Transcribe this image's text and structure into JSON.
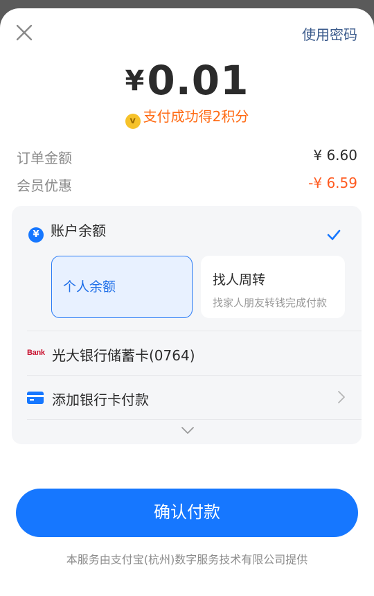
{
  "header": {
    "close_icon": "close-icon",
    "use_password": "使用密码"
  },
  "payment": {
    "currency_symbol": "¥",
    "amount": "0.01",
    "points_icon": "coin-icon",
    "points_text": "支付成功得2积分"
  },
  "summary": {
    "order_label": "订单金额",
    "order_value": "¥ 6.60",
    "discount_label": "会员优惠",
    "discount_value": "-¥ 6.59"
  },
  "methods": {
    "balance": {
      "icon_text": "¥",
      "label": "账户余额",
      "selected": true
    },
    "personal_balance": {
      "label": "个人余额"
    },
    "friend": {
      "label": "找人周转",
      "sub": "找家人朋友转钱完成付款"
    },
    "bank": {
      "logo_text": "Bank",
      "label": "光大银行储蓄卡(0764)"
    },
    "add_card": {
      "label": "添加银行卡付款"
    }
  },
  "confirm_label": "确认付款",
  "footer_text": "本服务由支付宝(杭州)数字服务技术有限公司提供",
  "colors": {
    "accent": "#1677ff",
    "points": "#ff6a13",
    "discount": "#ff5a1f"
  }
}
